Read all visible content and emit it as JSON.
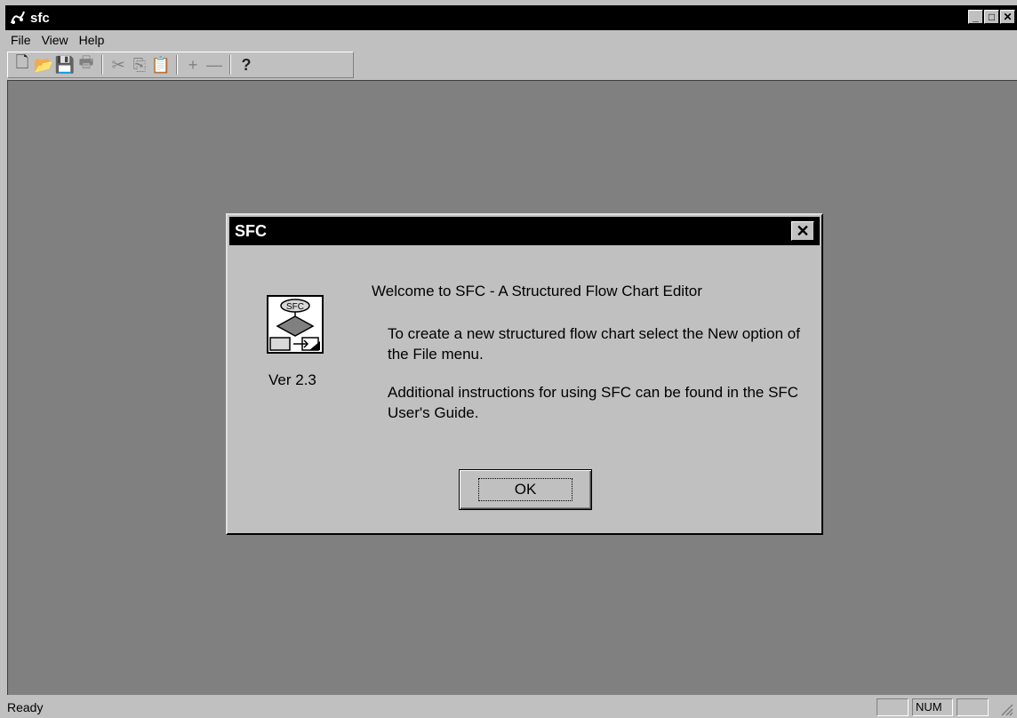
{
  "window": {
    "title": "sfc",
    "caption_buttons": {
      "minimize": "_",
      "maximize": "□",
      "close": "✕"
    }
  },
  "menubar": {
    "items": [
      {
        "label": "File"
      },
      {
        "label": "View"
      },
      {
        "label": "Help"
      }
    ]
  },
  "toolbar": {
    "buttons": [
      {
        "icon": "new-document-icon",
        "glyph": "🗋"
      },
      {
        "icon": "open-folder-icon",
        "glyph": "📂"
      },
      {
        "icon": "save-icon",
        "glyph": "💾"
      },
      {
        "icon": "print-icon",
        "glyph": "🖶"
      },
      {
        "icon": "cut-icon",
        "glyph": "✂"
      },
      {
        "icon": "copy-icon",
        "glyph": "⎘"
      },
      {
        "icon": "paste-icon",
        "glyph": "📋"
      },
      {
        "icon": "plus-icon",
        "glyph": "+"
      },
      {
        "icon": "minus-icon",
        "glyph": "—"
      },
      {
        "icon": "help-icon",
        "glyph": "?"
      }
    ]
  },
  "dialog": {
    "title": "SFC",
    "close_glyph": "✕",
    "icon_label": "SFC",
    "version": "Ver 2.3",
    "welcome": "Welcome to SFC - A Structured Flow Chart Editor",
    "paragraph1": "To create a new structured flow chart select the New option of the File menu.",
    "paragraph2": "Additional instructions for using SFC can be found in the SFC User's Guide.",
    "ok_label": "OK"
  },
  "statusbar": {
    "text": "Ready",
    "num_indicator": "NUM"
  }
}
